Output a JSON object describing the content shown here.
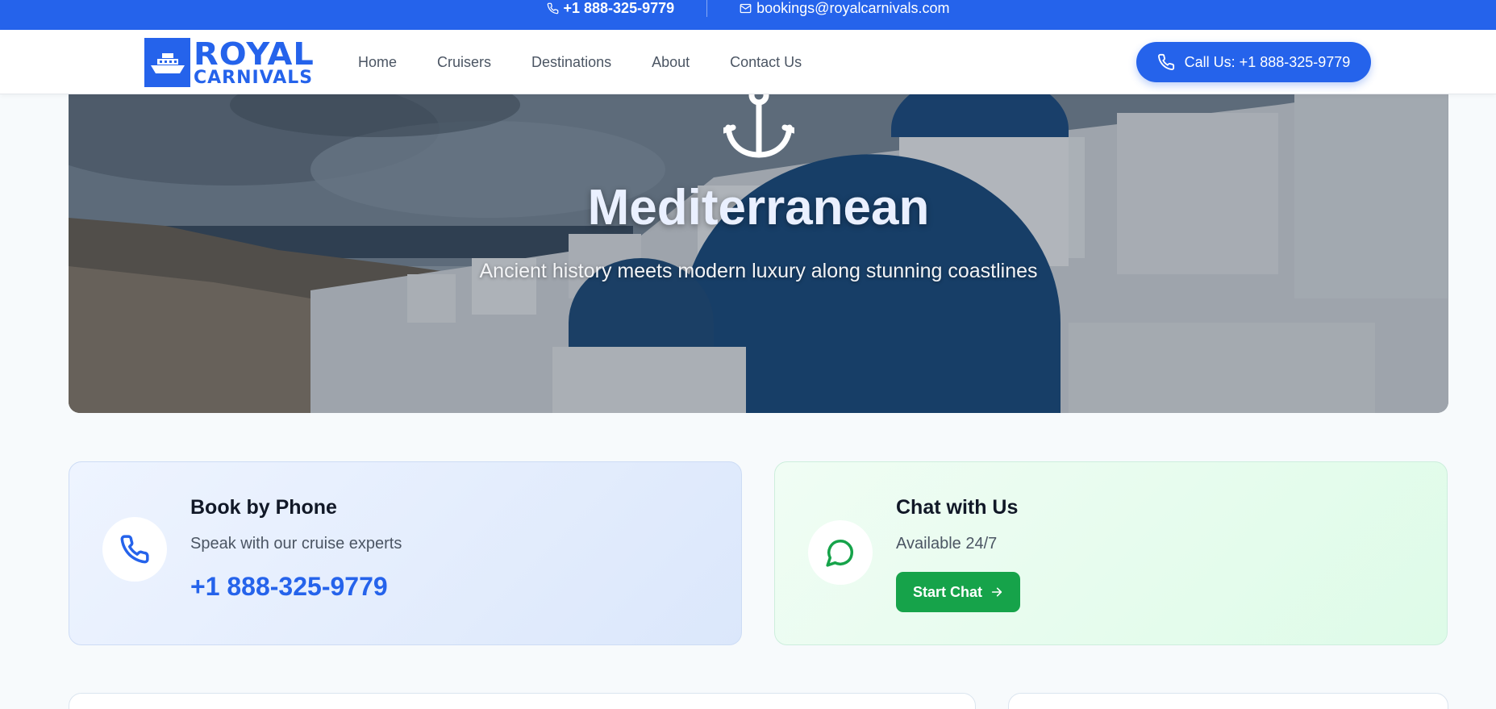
{
  "topbar": {
    "phone": "+1 888-325-9779",
    "email": "bookings@royalcarnivals.com",
    "phone_icon": "phone-icon",
    "email_icon": "mail-icon"
  },
  "header": {
    "logo": {
      "line1": "ROYAL",
      "line2": "CARNIVALS",
      "icon": "ship-icon"
    },
    "nav": [
      {
        "label": "Home"
      },
      {
        "label": "Cruisers"
      },
      {
        "label": "Destinations"
      },
      {
        "label": "About"
      },
      {
        "label": "Contact Us"
      }
    ],
    "call_button": {
      "label": "Call Us: +1 888-325-9779",
      "icon": "phone-icon"
    }
  },
  "hero": {
    "icon": "anchor-icon",
    "title": "Mediterranean",
    "subtitle": "Ancient history meets modern luxury along stunning coastlines"
  },
  "cards": {
    "phone": {
      "title": "Book by Phone",
      "description": "Speak with our cruise experts",
      "phone": "+1 888-325-9779",
      "icon": "phone-icon"
    },
    "chat": {
      "title": "Chat with Us",
      "description": "Available 24/7",
      "button_label": "Start Chat",
      "icon": "chat-bubble-icon",
      "button_icon": "arrow-right-icon"
    }
  },
  "colors": {
    "brand_blue": "#2563eb",
    "chat_green": "#16a34a",
    "page_bg": "#f7fafc"
  }
}
